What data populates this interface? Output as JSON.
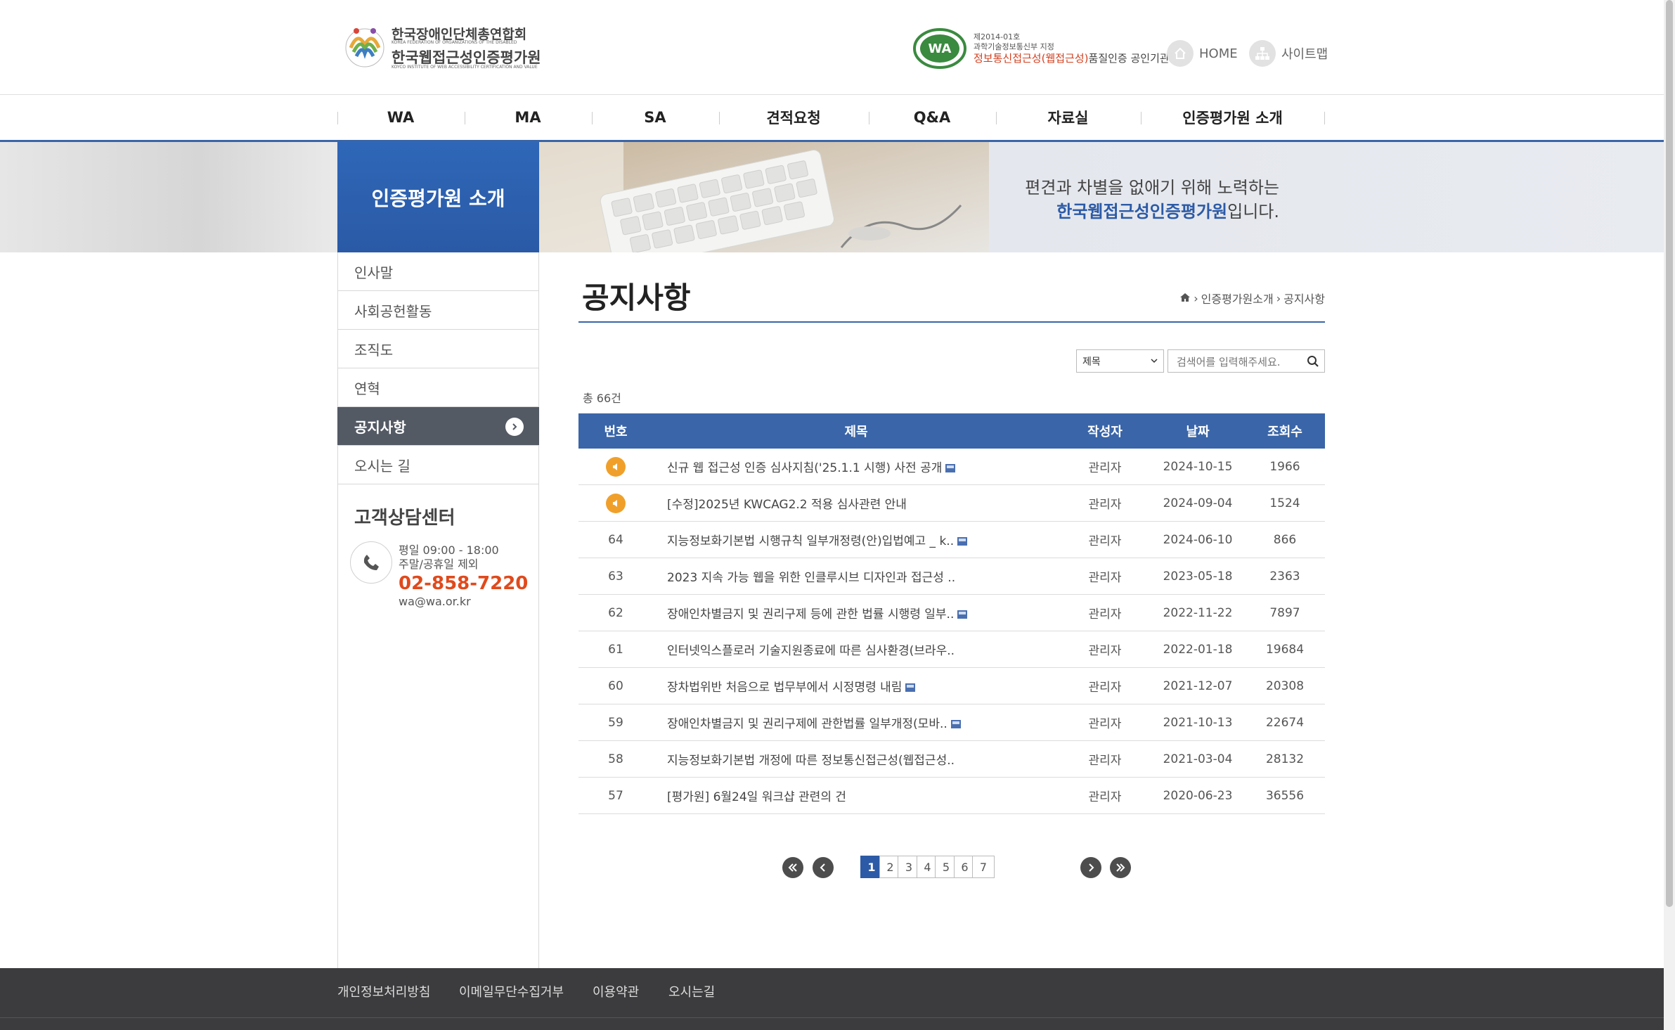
{
  "header": {
    "logo_line1": "한국장애인단체총연합회",
    "logo_line1_sub": "KOREA FEDERATION OF ORGANIZATIONS OF THE DISABLED",
    "logo_line2": "한국웹접근성인증평가원",
    "logo_line2_sub": "KOYCO INSTITUTE OF WEB ACCESSIBILITY CERTIFICATION AND VALUE",
    "cert_line1": "제2014-01호",
    "cert_line2": "과학기술정보통신부 지정",
    "cert_line3_a": "정보통신접근성(웹접근성)",
    "cert_line3_b": "품질인증 공인기관",
    "home_label": "HOME",
    "sitemap_label": "사이트맵"
  },
  "gnb": [
    "WA",
    "MA",
    "SA",
    "견적요청",
    "Q&A",
    "자료실",
    "인증평가원 소개"
  ],
  "banner": {
    "section_title": "인증평가원 소개",
    "slogan_line1": "편견과 차별을 없애기 위해 노력하는",
    "slogan_line2_strong": "한국웹접근성인증평가원",
    "slogan_line2_rest": "입니다."
  },
  "lnb": {
    "items": [
      "인사말",
      "사회공헌활동",
      "조직도",
      "연혁",
      "공지사항",
      "오시는 길"
    ],
    "active_index": 4
  },
  "customer_center": {
    "title": "고객상담센터",
    "hours1": "평일 09:00 - 18:00",
    "hours2": "주말/공휴일 제외",
    "phone": "02-858-7220",
    "email": "wa@wa.or.kr"
  },
  "content": {
    "page_title": "공지사항",
    "breadcrumb": [
      "인증평가원소개",
      "공지사항"
    ],
    "search_select": "제목",
    "search_placeholder": "검색어를 입력해주세요.",
    "total": "총 66건",
    "columns": [
      "번호",
      "제목",
      "작성자",
      "날짜",
      "조회수"
    ],
    "rows": [
      {
        "no": "",
        "notice": true,
        "title": "신규 웹 접근성 인증 심사지침('25.1.1 시행) 사전 공개",
        "file": true,
        "author": "관리자",
        "date": "2024-10-15",
        "views": "1966"
      },
      {
        "no": "",
        "notice": true,
        "title": "[수정]2025년 KWCAG2.2 적용 심사관련 안내",
        "file": false,
        "author": "관리자",
        "date": "2024-09-04",
        "views": "1524"
      },
      {
        "no": "64",
        "notice": false,
        "title": "지능정보화기본법 시행규칙 일부개정령(안)입법예고 _ k..",
        "file": true,
        "author": "관리자",
        "date": "2024-06-10",
        "views": "866"
      },
      {
        "no": "63",
        "notice": false,
        "title": "2023 지속 가능 웹을 위한 인클루시브 디자인과 접근성 ..",
        "file": false,
        "author": "관리자",
        "date": "2023-05-18",
        "views": "2363"
      },
      {
        "no": "62",
        "notice": false,
        "title": "장애인차별금지 및 권리구제 등에 관한 법률 시행령 일부..",
        "file": true,
        "author": "관리자",
        "date": "2022-11-22",
        "views": "7897"
      },
      {
        "no": "61",
        "notice": false,
        "title": "인터넷익스플로러 기술지원종료에 따른 심사환경(브라우..",
        "file": false,
        "author": "관리자",
        "date": "2022-01-18",
        "views": "19684"
      },
      {
        "no": "60",
        "notice": false,
        "title": "장차법위반 처음으로 법무부에서 시정명령 내림",
        "file": true,
        "author": "관리자",
        "date": "2021-12-07",
        "views": "20308"
      },
      {
        "no": "59",
        "notice": false,
        "title": "장애인차별금지 및 권리구제에 관한법률 일부개정(모바..",
        "file": true,
        "author": "관리자",
        "date": "2021-10-13",
        "views": "22674"
      },
      {
        "no": "58",
        "notice": false,
        "title": "지능정보화기본법 개정에 따른 정보통신접근성(웹접근성..",
        "file": false,
        "author": "관리자",
        "date": "2021-03-04",
        "views": "28132"
      },
      {
        "no": "57",
        "notice": false,
        "title": "[평가원] 6월24일 워크샵 관련의 건",
        "file": false,
        "author": "관리자",
        "date": "2020-06-23",
        "views": "36556"
      }
    ],
    "pages": [
      "1",
      "2",
      "3",
      "4",
      "5",
      "6",
      "7"
    ],
    "current_page": "1"
  },
  "footer": {
    "links": [
      "개인정보처리방침",
      "이메일무단수집거부",
      "이용약관",
      "오시는길"
    ]
  },
  "colors": {
    "primary": "#3a65a8",
    "accent_orange": "#e04a1c",
    "notice_icon": "#f0a02a",
    "lnb_active": "#535a64",
    "footer_bg": "#3c3c3e"
  }
}
